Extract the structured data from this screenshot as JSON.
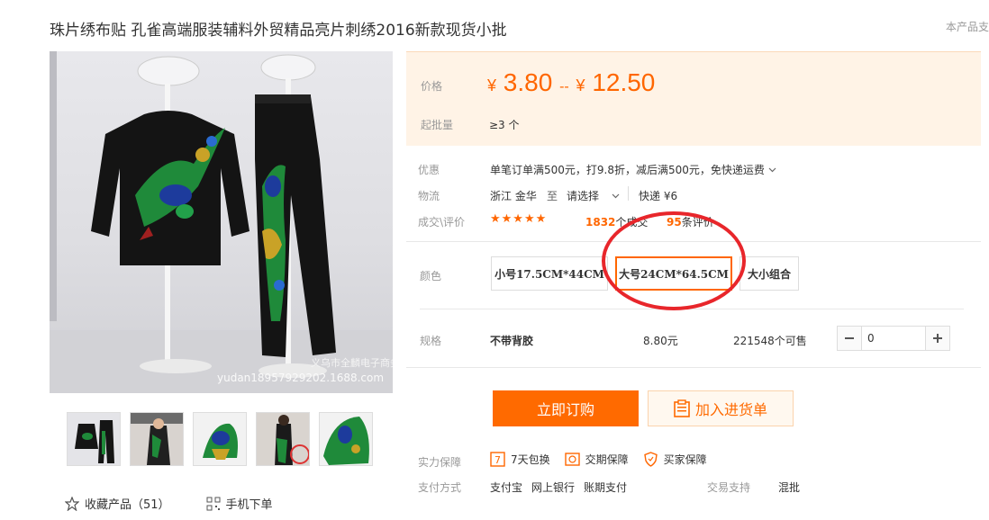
{
  "header": {
    "title": "珠片绣布贴 孔雀高端服装辅料外贸精品亮片刺绣2016新款现货小批",
    "support_text": "本产品支"
  },
  "gallery": {
    "watermark_company": "义乌市全麟电子商务商行",
    "watermark_url": "yudan18957929202.1688.com",
    "thumbnail_count": 5
  },
  "actions_left": {
    "favorite_label": "收藏产品（51）",
    "mobile_label": "手机下单"
  },
  "price": {
    "label": "价格",
    "currency": "¥",
    "low": "3.80",
    "separator": "--",
    "high": "12.50",
    "moq_label": "起批量",
    "moq_value": "≥3 个"
  },
  "promo": {
    "label": "优惠",
    "text": "单笔订单满500元，打9.8折，减后满500元，免快递运费"
  },
  "logistics": {
    "label": "物流",
    "origin": "浙江 金华",
    "to": "至",
    "select_label": "请选择",
    "express": "快递 ¥6"
  },
  "reviews": {
    "label": "成交\\评价",
    "stars": "★★★★★",
    "deals_count": "1832",
    "deals_unit": "个成交",
    "reviews_count": "95",
    "reviews_unit": "条评价"
  },
  "color": {
    "label": "颜色",
    "options": [
      "小号17.5CM*44CM",
      "大号24CM*64.5CM",
      "大小组合"
    ],
    "selected": "大号24CM*64.5CM"
  },
  "spec": {
    "label": "规格",
    "name": "不带背胶",
    "price": "8.80元",
    "stock": "221548个可售",
    "quantity": "0"
  },
  "buttons": {
    "order": "立即订购",
    "cart": "加入进货单"
  },
  "guarantee": {
    "label": "实力保障",
    "items": [
      "7天包换",
      "交期保障",
      "买家保障"
    ]
  },
  "payment": {
    "label": "支付方式",
    "methods": [
      "支付宝",
      "网上银行",
      "账期支付"
    ],
    "trade_label": "交易支持",
    "trade_value": "混批"
  },
  "colors": {
    "accent": "#ff6600",
    "price_bg": "#fff3e6",
    "annotation": "#e8262b"
  }
}
